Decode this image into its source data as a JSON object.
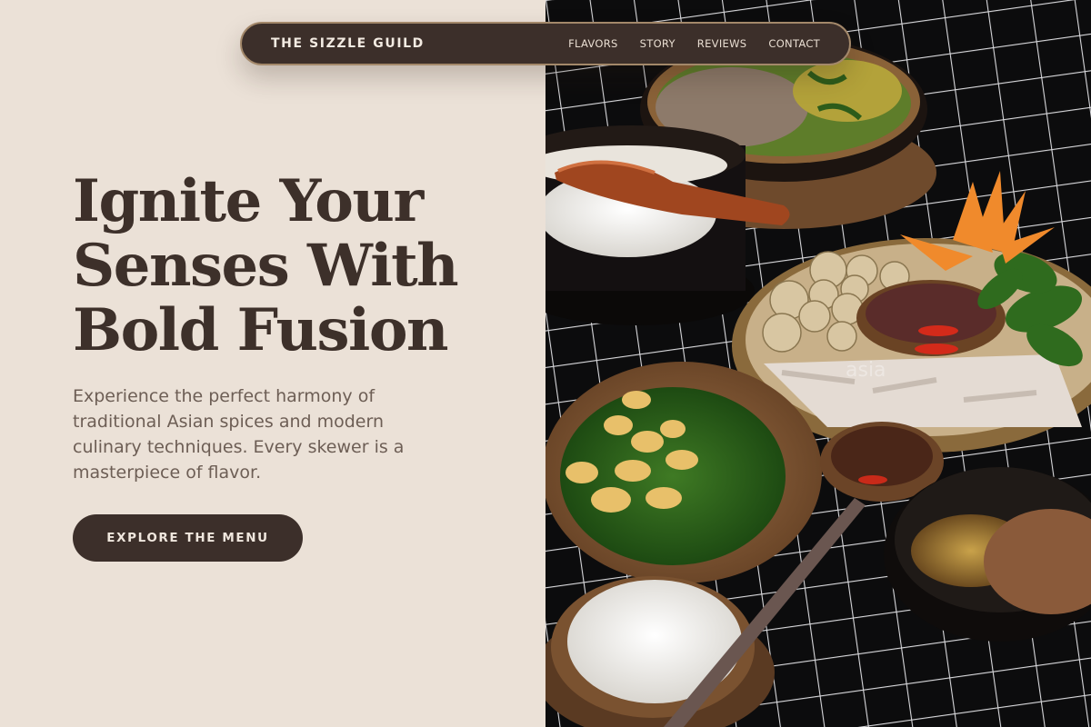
{
  "nav": {
    "brand": "THE SIZZLE GUILD",
    "links": [
      "FLAVORS",
      "STORY",
      "REVIEWS",
      "CONTACT"
    ]
  },
  "hero": {
    "headline_lines": [
      "Ignite Your",
      "Senses With",
      "Bold Fusion"
    ],
    "subtext": "Experience the perfect harmony of traditional Asian spices and modern culinary techniques. Every skewer is a masterpiece of flavor.",
    "cta_label": "EXPLORE THE MENU"
  },
  "photo": {
    "watermark": "asia"
  },
  "colors": {
    "background": "#ebe1d7",
    "primary_dark": "#3c2f2a",
    "nav_border": "#a3886a",
    "headline": "#3d302a",
    "body_text": "#6d5e55"
  }
}
